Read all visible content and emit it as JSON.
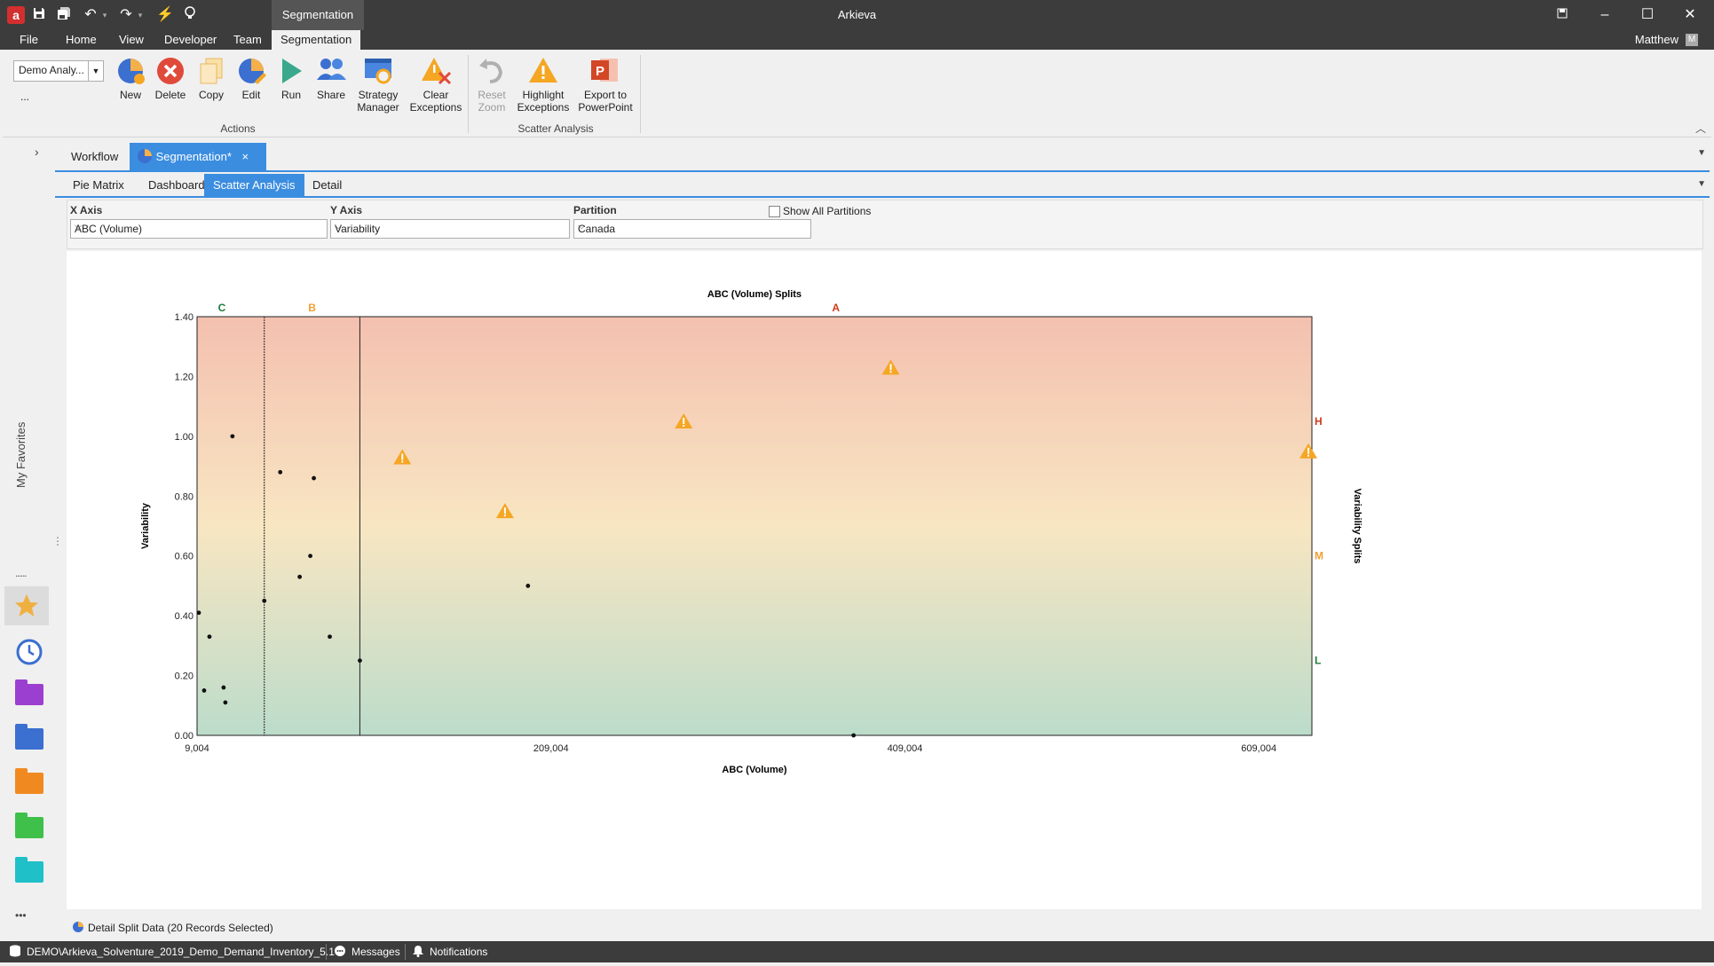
{
  "titlebar": {
    "app_logo": "a",
    "context_tab": "Segmentation",
    "app_title": "Arkieva",
    "window_buttons": [
      "restore-down",
      "minimize",
      "maximize",
      "close"
    ]
  },
  "menu": {
    "items": [
      "File",
      "Home",
      "View",
      "Developer",
      "Team",
      "Segmentation"
    ],
    "user": "Matthew",
    "avatar": "M"
  },
  "ribbon": {
    "dataset_select": "Demo Analy...",
    "more": "...",
    "actions_group": "Actions",
    "scatter_group": "Scatter Analysis",
    "buttons": {
      "new": [
        "New"
      ],
      "delete": [
        "Delete"
      ],
      "copy": [
        "Copy"
      ],
      "edit": [
        "Edit"
      ],
      "run": [
        "Run"
      ],
      "share": [
        "Share"
      ],
      "strategy": [
        "Strategy",
        "Manager"
      ],
      "clear": [
        "Clear",
        "Exceptions"
      ],
      "reset": [
        "Reset",
        "Zoom"
      ],
      "highlight": [
        "Highlight",
        "Exceptions"
      ],
      "export": [
        "Export to",
        "PowerPoint"
      ]
    }
  },
  "sidebar": {
    "label": "My Favorites",
    "dots": "......",
    "more": "•••"
  },
  "doc_tabs": {
    "workflow": "Workflow",
    "segmentation": "Segmentation*",
    "close": "×"
  },
  "sub_tabs": [
    "Pie Matrix",
    "Dashboard",
    "Scatter Analysis",
    "Detail"
  ],
  "filters": {
    "x_axis_label": "X Axis",
    "x_axis_value": "ABC (Volume)",
    "y_axis_label": "Y Axis",
    "y_axis_value": "Variability",
    "partition_label": "Partition",
    "partition_value": "Canada",
    "show_all_label": "Show All Partitions",
    "show_all_checked": false
  },
  "chart_data": {
    "type": "scatter",
    "title": "ABC (Volume) Splits",
    "xlabel": "ABC (Volume)",
    "ylabel": "Variability",
    "y2label": "Variability Splits",
    "xlim": [
      9004,
      639004
    ],
    "ylim": [
      0,
      1.4
    ],
    "x_ticks": [
      9004,
      209004,
      409004,
      609004
    ],
    "x_tick_labels": [
      "9,004",
      "209,004",
      "409,004",
      "609,004"
    ],
    "y_ticks": [
      0,
      0.2,
      0.4,
      0.6,
      0.8,
      1.0,
      1.2,
      1.4
    ],
    "y_tick_labels": [
      "0.00",
      "0.20",
      "0.40",
      "0.60",
      "0.80",
      "1.00",
      "1.20",
      "1.40"
    ],
    "x_splits": [
      47004,
      101004
    ],
    "x_split_labels": [
      {
        "label": "C",
        "x": 23004,
        "color": "#1f7a3a"
      },
      {
        "label": "B",
        "x": 74004,
        "color": "#f0a030"
      },
      {
        "label": "A",
        "x": 370004,
        "color": "#d03a1a"
      }
    ],
    "y_split_labels": [
      {
        "label": "H",
        "y": 1.05,
        "color": "#d03a1a"
      },
      {
        "label": "M",
        "y": 0.6,
        "color": "#f0a030"
      },
      {
        "label": "L",
        "y": 0.25,
        "color": "#1f7a3a"
      }
    ],
    "background_gradient": {
      "top": "#f4c0b0",
      "middle": "#f8e6c2",
      "bottom": "#bcdcca"
    },
    "points": [
      {
        "x": 10004,
        "y": 0.41
      },
      {
        "x": 13004,
        "y": 0.15
      },
      {
        "x": 16004,
        "y": 0.33
      },
      {
        "x": 24004,
        "y": 0.16
      },
      {
        "x": 25004,
        "y": 0.11
      },
      {
        "x": 29004,
        "y": 1.0
      },
      {
        "x": 47004,
        "y": 0.45
      },
      {
        "x": 56004,
        "y": 0.88
      },
      {
        "x": 67004,
        "y": 0.53
      },
      {
        "x": 73004,
        "y": 0.6
      },
      {
        "x": 75004,
        "y": 0.86
      },
      {
        "x": 84004,
        "y": 0.33
      },
      {
        "x": 101004,
        "y": 0.25
      },
      {
        "x": 196004,
        "y": 0.5
      },
      {
        "x": 380004,
        "y": 0.0
      }
    ],
    "exceptions": [
      {
        "x": 125004,
        "y": 0.93
      },
      {
        "x": 183004,
        "y": 0.75
      },
      {
        "x": 284004,
        "y": 1.05
      },
      {
        "x": 401004,
        "y": 1.23
      },
      {
        "x": 637004,
        "y": 0.95
      }
    ],
    "exception_color": "#f5a623"
  },
  "detail_bar": "Detail Split Data (20 Records Selected)",
  "statusbar": {
    "db": "DEMO\\Arkieva_Solventure_2019_Demo_Demand_Inventory_5.1",
    "messages": "Messages",
    "notifications": "Notifications"
  }
}
